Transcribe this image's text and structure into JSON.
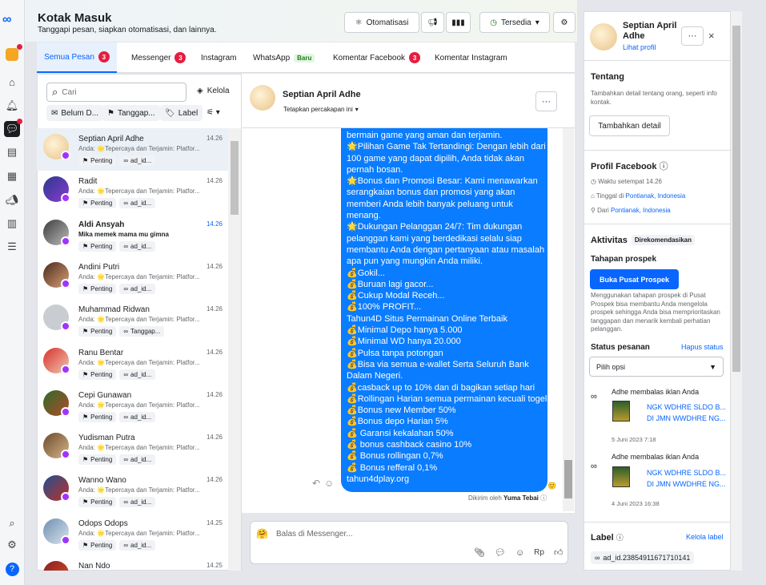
{
  "app": {
    "title": "Kotak Masuk",
    "subtitle": "Tanggapi pesan, siapkan otomatisasi, dan lainnya."
  },
  "toolbar": {
    "automation": "Otomatisasi",
    "status": "Tersedia"
  },
  "tabs": [
    {
      "label": "Semua Pesan",
      "count": "3"
    },
    {
      "label": "Messenger",
      "count": "3"
    },
    {
      "label": "Instagram"
    },
    {
      "label": "WhatsApp",
      "tag": "Baru"
    },
    {
      "label": "Komentar Facebook",
      "count": "3"
    },
    {
      "label": "Komentar Instagram"
    }
  ],
  "search": {
    "placeholder": "Cari",
    "manage": "Kelola"
  },
  "filters": {
    "unread": "Belum D...",
    "pending": "Tanggap...",
    "label": "Label"
  },
  "conversations": [
    {
      "name": "Septian April Adhe",
      "time": "14.26",
      "preview": "Anda: 🌟Tepercaya dan Terjamin: Platfor...",
      "tag1": "Penting",
      "tag2": "ad_id..."
    },
    {
      "name": "Radit",
      "time": "14.26",
      "preview": "Anda: 🌟Tepercaya dan Terjamin: Platfor...",
      "tag1": "Penting",
      "tag2": "ad_id..."
    },
    {
      "name": "Aldi Ansyah",
      "time": "14.26",
      "preview": "Mika memek mama mu gimna",
      "tag1": "Penting",
      "tag2": "ad_id..."
    },
    {
      "name": "Andini Putri",
      "time": "14.26",
      "preview": "Anda: 🌟Tepercaya dan Terjamin: Platfor...",
      "tag1": "Penting",
      "tag2": "ad_id..."
    },
    {
      "name": "Muhammad Ridwan",
      "time": "14.26",
      "preview": "Anda: 🌟Tepercaya dan Terjamin: Platfor...",
      "tag1": "Penting",
      "tag2": "Tanggap..."
    },
    {
      "name": "Ranu Bentar",
      "time": "14.26",
      "preview": "Anda: 🌟Tepercaya dan Terjamin: Platfor...",
      "tag1": "Penting",
      "tag2": "ad_id..."
    },
    {
      "name": "Cepi Gunawan",
      "time": "14.26",
      "preview": "Anda: 🌟Tepercaya dan Terjamin: Platfor...",
      "tag1": "Penting",
      "tag2": "ad_id..."
    },
    {
      "name": "Yudisman Putra",
      "time": "14.26",
      "preview": "Anda: 🌟Tepercaya dan Terjamin: Platfor...",
      "tag1": "Penting",
      "tag2": "ad_id..."
    },
    {
      "name": "Wanno Wano",
      "time": "14.26",
      "preview": "Anda: 🌟Tepercaya dan Terjamin: Platfor...",
      "tag1": "Penting",
      "tag2": "ad_id..."
    },
    {
      "name": "Odops Odops",
      "time": "14.25",
      "preview": "Anda: 🌟Tepercaya dan Terjamin: Platfor...",
      "tag1": "Penting",
      "tag2": "ad_id..."
    },
    {
      "name": "Nan Ndo",
      "time": "14.25",
      "preview": "",
      "tag1": "",
      "tag2": ""
    }
  ],
  "chat": {
    "name": "Septian April Adhe",
    "assign": "Tetapkan percakapan ini",
    "sent_by": "Dikirim oleh",
    "sender": "Yuma Tebai",
    "compose_placeholder": "Balas di Messenger...",
    "compose_rp": "Rp"
  },
  "message_lines": [
    "bermain game yang aman dan terjamin.",
    "🌟Pilihan Game Tak Tertandingi: Dengan lebih dari",
    "100 game yang dapat dipilih, Anda tidak akan",
    "pernah bosan.",
    "🌟Bonus dan Promosi Besar: Kami menawarkan",
    "serangkaian bonus dan promosi yang akan",
    "memberi Anda lebih banyak peluang untuk",
    "menang.",
    "🌟Dukungan Pelanggan 24/7: Tim dukungan",
    "pelanggan kami yang berdedikasi selalu siap",
    "membantu Anda dengan pertanyaan atau masalah",
    "apa pun yang mungkin Anda miliki.",
    "💰Gokil...",
    "💰Buruan lagi gacor...",
    "💰Cukup Modal Receh...",
    "💰100% PROFIT...",
    "Tahun4D Situs Permainan Online Terbaik",
    "💰Minimal Depo hanya 5.000",
    "💰Minimal WD hanya 20.000",
    "💰Pulsa tanpa potongan",
    "💰Bisa via semua e-wallet Serta Seluruh Bank",
    "Dalam Negeri.",
    "💰casback up to 10% dan di bagikan setiap hari",
    "💰Rollingan Harian semua permainan kecuali togel",
    "💰Bonus new Member 50%",
    "💰Bonus depo Harian 5%",
    "💰 Garansi kekalahan 50%",
    "💰 bonus cashback casino 10%",
    "💰 Bonus rollingan 0,7%",
    "💰 Bonus refferal 0,1%",
    "tahun4dplay.org"
  ],
  "profile": {
    "name": "Septian April Adhe",
    "view": "Lihat profil"
  },
  "about": {
    "title": "Tentang",
    "desc": "Tambahkan detail tentang orang, seperti info kontak.",
    "button": "Tambahkan detail"
  },
  "fb_profile": {
    "title": "Profil Facebook",
    "local_time": "Waktu setempat 14.26",
    "lives_pre": "Tinggal di ",
    "lives_city": "Pontianak, Indonesia",
    "from_pre": "Dari ",
    "from_city": "Pontianak, Indonesia"
  },
  "activity": {
    "title": "Aktivitas",
    "tag": "Direkomendasikan",
    "stage_title": "Tahapan prospek",
    "open_btn": "Buka Pusat Prospek",
    "stage_desc": "Menggunakan tahapan prospek di Pusat Prospek bisa membantu Anda mengelola prospek sehingga Anda bisa memprioritaskan tanggapan dan menarik kembali perhatian pelanggan.",
    "order_title": "Status pesanan",
    "order_clear": "Hapus status",
    "order_select": "Pilih opsi",
    "events": [
      {
        "title": "Adhe membalas iklan Anda",
        "line1": "NGK WDHRE SLDO B...",
        "line2": "DI JMN WWDHRE NG...",
        "date": "5 Juni 2023 7:18"
      },
      {
        "title": "Adhe membalas iklan Anda",
        "line1": "NGK WDHRE SLDO B...",
        "line2": "DI JMN WWDHRE NG...",
        "date": "4 Juni 2023 16:38"
      }
    ]
  },
  "labels": {
    "title": "Label",
    "manage": "Kelola label",
    "item": "ad_id.23854911671710141"
  },
  "colors": {
    "accent": "#0866ff",
    "bubble": "#0a7cff",
    "badge": "#e41e3f"
  }
}
